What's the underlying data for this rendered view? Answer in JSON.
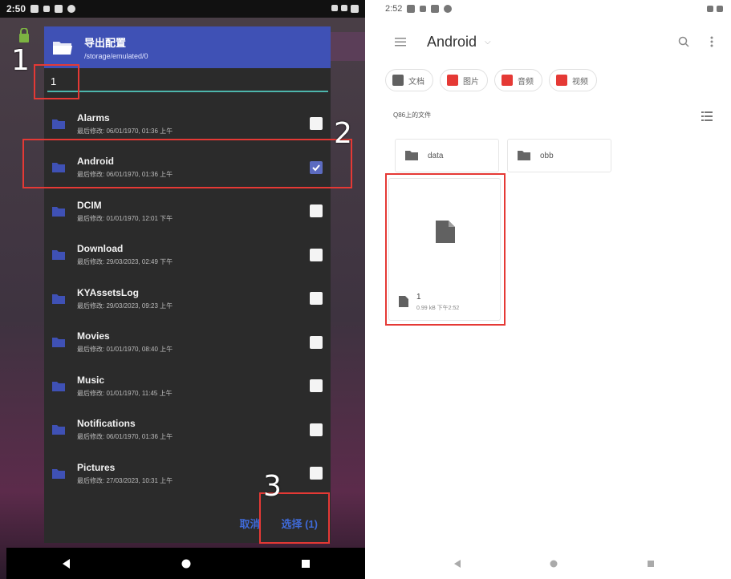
{
  "left": {
    "status": {
      "time": "2:50"
    },
    "dialog": {
      "title": "导出配置",
      "path": "/storage/emulated/0",
      "filename_value": "1",
      "items": [
        {
          "name": "Alarms",
          "meta": "最后修改: 06/01/1970, 01:36 上午",
          "checked": false
        },
        {
          "name": "Android",
          "meta": "最后修改: 06/01/1970, 01:36 上午",
          "checked": true
        },
        {
          "name": "DCIM",
          "meta": "最后修改: 01/01/1970, 12:01 下午",
          "checked": false
        },
        {
          "name": "Download",
          "meta": "最后修改: 29/03/2023, 02:49 下午",
          "checked": false
        },
        {
          "name": "KYAssetsLog",
          "meta": "最后修改: 29/03/2023, 09:23 上午",
          "checked": false
        },
        {
          "name": "Movies",
          "meta": "最后修改: 01/01/1970, 08:40 上午",
          "checked": false
        },
        {
          "name": "Music",
          "meta": "最后修改: 01/01/1970, 11:45 上午",
          "checked": false
        },
        {
          "name": "Notifications",
          "meta": "最后修改: 06/01/1970, 01:36 上午",
          "checked": false
        },
        {
          "name": "Pictures",
          "meta": "最后修改: 27/03/2023, 10:31 上午",
          "checked": false
        }
      ],
      "cancel_label": "取消",
      "select_label": "选择 (1)"
    },
    "annotations": [
      "1",
      "2",
      "3"
    ]
  },
  "right": {
    "status": {
      "time": "2:52"
    },
    "title": "Android",
    "chips": [
      {
        "label": "文档",
        "color": "#616161"
      },
      {
        "label": "图片",
        "color": "#e53935"
      },
      {
        "label": "音频",
        "color": "#e53935"
      },
      {
        "label": "视频",
        "color": "#e53935"
      }
    ],
    "section_label": "Q86上的文件",
    "folders": [
      "data",
      "obb"
    ],
    "file": {
      "name": "1",
      "meta": "0.99 kB 下午2:52"
    }
  },
  "colors": {
    "dialog_header": "#3f51b5",
    "accent_blue": "#3f6ad8",
    "annotation_red": "#e53935"
  }
}
